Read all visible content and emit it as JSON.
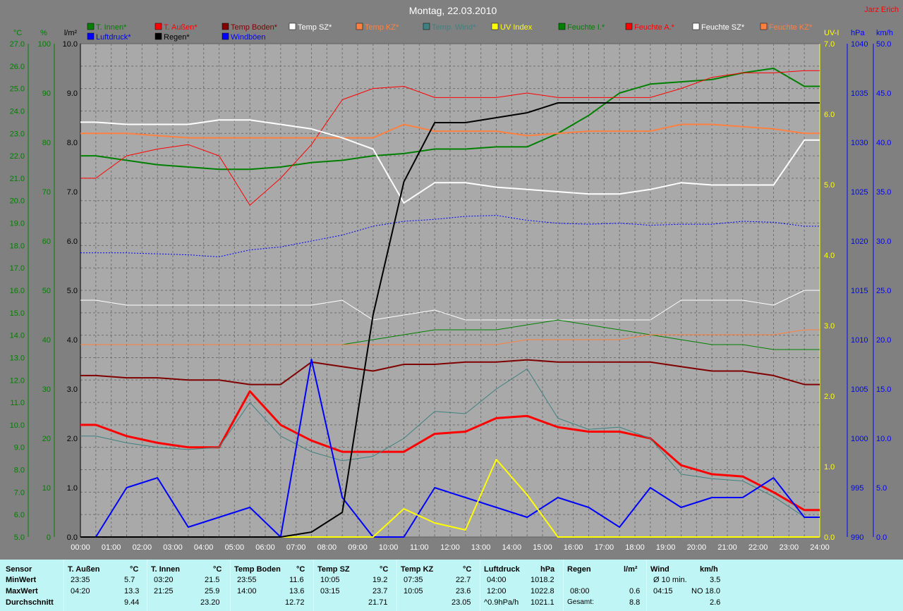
{
  "chart_data": {
    "type": "line",
    "title": "Montag, 22.03.2010",
    "author": "Jarz Erich",
    "x": [
      "00:00",
      "01:00",
      "02:00",
      "03:00",
      "04:00",
      "05:00",
      "06:00",
      "07:00",
      "08:00",
      "09:00",
      "10:00",
      "11:00",
      "12:00",
      "13:00",
      "14:00",
      "15:00",
      "16:00",
      "17:00",
      "18:00",
      "19:00",
      "20:00",
      "21:00",
      "22:00",
      "23:00",
      "24:00"
    ],
    "axes": {
      "temp_c": {
        "label": "°C",
        "ticks": [
          "27.0",
          "26.0",
          "25.0",
          "24.0",
          "23.0",
          "22.0",
          "21.0",
          "20.0",
          "19.0",
          "18.0",
          "17.0",
          "16.0",
          "15.0",
          "14.0",
          "13.0",
          "12.0",
          "11.0",
          "10.0",
          "9.0",
          "8.0",
          "7.0",
          "6.0",
          "5.0"
        ],
        "range": [
          5,
          27
        ]
      },
      "humidity_pct": {
        "label": "%",
        "ticks": [
          "100",
          "90",
          "80",
          "70",
          "60",
          "50",
          "40",
          "30",
          "20",
          "10",
          "0"
        ],
        "range": [
          0,
          100
        ]
      },
      "rain_lm2": {
        "label": "l/m²",
        "ticks": [
          "10.0",
          "9.0",
          "8.0",
          "7.0",
          "6.0",
          "5.0",
          "4.0",
          "3.0",
          "2.0",
          "1.0",
          "0.0"
        ],
        "range": [
          0,
          10
        ]
      },
      "uv": {
        "label": "UV-I",
        "ticks": [
          "7.0",
          "6.0",
          "5.0",
          "4.0",
          "3.0",
          "2.0",
          "1.0",
          "0.0"
        ],
        "range": [
          0,
          7
        ]
      },
      "pressure_hpa": {
        "label": "hPa",
        "ticks": [
          "1040",
          "1035",
          "1030",
          "1025",
          "1020",
          "1015",
          "1010",
          "1005",
          "1000",
          "995",
          "990"
        ],
        "range": [
          990,
          1040
        ]
      },
      "wind_kmh": {
        "label": "km/h",
        "ticks": [
          "50.0",
          "45.0",
          "40.0",
          "35.0",
          "30.0",
          "25.0",
          "20.0",
          "15.0",
          "10.0",
          "5.0",
          "0.0"
        ],
        "range": [
          0,
          50
        ]
      }
    },
    "legend": [
      {
        "name": "T. Innen*",
        "color": "#008000"
      },
      {
        "name": "T. Außen*",
        "color": "#ff0000"
      },
      {
        "name": "Temp Boden*",
        "color": "#800000"
      },
      {
        "name": "Temp SZ*",
        "color": "#ffffff"
      },
      {
        "name": "Temp KZ*",
        "color": "#ff8040"
      },
      {
        "name": "Temp. Wind*",
        "color": "#408080"
      },
      {
        "name": "UV Index",
        "color": "#ffff00"
      },
      {
        "name": "Feuchte I.*",
        "color": "#008000"
      },
      {
        "name": "Feuchte A.*",
        "color": "#ff0000"
      },
      {
        "name": "Feuchte SZ*",
        "color": "#ffffff"
      },
      {
        "name": "Feuchte KZ*",
        "color": "#ff8040"
      },
      {
        "name": "Luftdruck*",
        "color": "#0000ff"
      },
      {
        "name": "Regen*",
        "color": "#000000"
      },
      {
        "name": "Windböen",
        "color": "#0000ff"
      }
    ],
    "series": [
      {
        "name": "T. Innen*",
        "axis": "temp_c",
        "color": "#008000",
        "width": 2,
        "values": [
          22.0,
          21.8,
          21.6,
          21.5,
          21.4,
          21.4,
          21.5,
          21.7,
          21.8,
          22.0,
          22.1,
          22.3,
          22.3,
          22.4,
          22.4,
          23.0,
          23.8,
          24.8,
          25.2,
          25.3,
          25.4,
          25.7,
          25.9,
          25.1
        ]
      },
      {
        "name": "T. Außen*",
        "axis": "temp_c",
        "color": "#ff0000",
        "width": 1,
        "values": [
          21.0,
          22.0,
          22.3,
          22.5,
          22.0,
          19.8,
          21.0,
          22.5,
          24.5,
          25.0,
          25.1,
          24.6,
          24.6,
          24.6,
          24.8,
          24.6,
          24.6,
          24.6,
          24.6,
          25.0,
          25.5,
          25.7,
          25.7,
          25.8
        ]
      },
      {
        "name": "Temp KZ*",
        "axis": "temp_c",
        "color": "#ff8040",
        "width": 2,
        "values": [
          23.0,
          23.0,
          22.9,
          22.8,
          22.8,
          22.8,
          22.8,
          22.8,
          22.8,
          22.8,
          23.4,
          23.1,
          23.1,
          23.1,
          22.9,
          23.0,
          23.1,
          23.1,
          23.1,
          23.4,
          23.4,
          23.3,
          23.2,
          23.0
        ]
      },
      {
        "name": "Temp SZ*",
        "axis": "temp_c",
        "color": "#ffffff",
        "width": 2,
        "values": [
          23.5,
          23.4,
          23.4,
          23.4,
          23.6,
          23.6,
          23.4,
          23.2,
          22.8,
          22.3,
          19.9,
          20.8,
          20.8,
          20.6,
          20.5,
          20.4,
          20.3,
          20.3,
          20.5,
          20.8,
          20.7,
          20.7,
          20.7,
          22.7
        ]
      },
      {
        "name": "Temp Boden*",
        "axis": "temp_c",
        "color": "#800000",
        "width": 2,
        "values": [
          12.2,
          12.1,
          12.1,
          12.0,
          12.0,
          11.8,
          11.8,
          12.8,
          12.6,
          12.4,
          12.7,
          12.7,
          12.8,
          12.8,
          12.9,
          12.8,
          12.8,
          12.8,
          12.8,
          12.6,
          12.4,
          12.4,
          12.2,
          11.8
        ]
      },
      {
        "name": "T. Außen (Boden-Skala)",
        "axis": "temp_c",
        "color": "#ff0000",
        "width": 3,
        "values": [
          10.0,
          9.5,
          9.2,
          9.0,
          9.0,
          11.5,
          10.0,
          9.3,
          8.8,
          8.8,
          8.8,
          9.6,
          9.7,
          10.3,
          10.4,
          9.9,
          9.7,
          9.7,
          9.4,
          8.2,
          7.8,
          7.7,
          7.0,
          6.2
        ]
      },
      {
        "name": "Temp. Wind*",
        "axis": "temp_c",
        "color": "#408080",
        "width": 1,
        "values": [
          9.5,
          9.2,
          9.0,
          8.9,
          9.0,
          11.0,
          9.5,
          8.8,
          8.4,
          8.6,
          9.4,
          10.6,
          10.5,
          11.6,
          12.5,
          10.3,
          9.8,
          9.9,
          9.4,
          7.8,
          7.6,
          7.5,
          6.8,
          5.9
        ]
      },
      {
        "name": "Feuchte SZ*",
        "axis": "humidity_pct",
        "color": "#ffffff",
        "width": 1,
        "values": [
          48,
          47,
          47,
          47,
          47,
          47,
          47,
          47,
          48,
          44,
          45,
          46,
          44,
          44,
          44,
          44,
          44,
          44,
          44,
          48,
          48,
          48,
          47,
          50
        ]
      },
      {
        "name": "Feuchte I.*",
        "axis": "humidity_pct",
        "color": "#008000",
        "width": 1,
        "values": [
          39,
          39,
          39,
          39,
          39,
          39,
          39,
          39,
          39,
          40,
          41,
          42,
          42,
          42,
          43,
          44,
          43,
          42,
          41,
          40,
          39,
          39,
          38,
          38
        ]
      },
      {
        "name": "Feuchte KZ*",
        "axis": "humidity_pct",
        "color": "#ff8040",
        "width": 1,
        "values": [
          39,
          39,
          39,
          39,
          39,
          39,
          39,
          39,
          39,
          39,
          39,
          39,
          39,
          39,
          40,
          40,
          40,
          40,
          41,
          41,
          41,
          41,
          41,
          42
        ]
      },
      {
        "name": "Luftdruck*",
        "axis": "pressure_hpa",
        "color": "#0000ff",
        "width": 1,
        "dashed": true,
        "values": [
          1018.8,
          1018.8,
          1018.7,
          1018.6,
          1018.4,
          1019.1,
          1019.4,
          1020.0,
          1020.6,
          1021.5,
          1022.0,
          1022.2,
          1022.5,
          1022.6,
          1022.1,
          1021.8,
          1021.7,
          1021.8,
          1021.6,
          1021.7,
          1021.7,
          1022.0,
          1021.9,
          1021.5
        ]
      },
      {
        "name": "Windböen",
        "axis": "wind_kmh",
        "color": "#0000ff",
        "width": 2,
        "values": [
          0,
          5,
          6,
          1,
          2,
          3,
          0,
          18,
          4,
          0,
          0,
          5,
          4,
          3,
          2,
          4,
          3,
          1,
          5,
          3,
          4,
          4,
          6,
          2
        ]
      },
      {
        "name": "UV Index",
        "axis": "uv",
        "color": "#ffff00",
        "width": 2,
        "values": [
          0,
          0,
          0,
          0,
          0,
          0,
          0,
          0,
          0,
          0,
          0.4,
          0.2,
          0.1,
          1.1,
          0.6,
          0,
          0,
          0,
          0,
          0,
          0,
          0,
          0,
          0
        ]
      },
      {
        "name": "Regen*",
        "axis": "rain_lm2",
        "color": "#000000",
        "width": 2,
        "values": [
          0,
          0,
          0,
          0,
          0,
          0,
          0,
          0.1,
          0.5,
          4.5,
          7.2,
          8.4,
          8.4,
          8.5,
          8.6,
          8.8,
          8.8,
          8.8,
          8.8,
          8.8,
          8.8,
          8.8,
          8.8,
          8.8
        ]
      }
    ]
  },
  "stats": {
    "headers": {
      "sensor": "Sensor",
      "t_aussen": "T. Außen",
      "t_aussen_unit": "°C",
      "t_innen": "T. Innen",
      "t_innen_unit": "°C",
      "temp_boden": "Temp Boden",
      "temp_boden_unit": "°C",
      "temp_sz": "Temp SZ",
      "temp_sz_unit": "°C",
      "temp_kz": "Temp KZ",
      "temp_kz_unit": "°C",
      "luftdruck": "Luftdruck",
      "luftdruck_unit": "hPa",
      "regen": "Regen",
      "regen_unit": "l/m²",
      "wind": "Wind",
      "wind_unit": "km/h"
    },
    "row_labels": {
      "min": "MinWert",
      "max": "MaxWert",
      "avg": "Durchschnitt"
    },
    "t_aussen": {
      "min_time": "23:35",
      "min": "5.7",
      "max_time": "04:20",
      "max": "13.3",
      "avg": "9.44"
    },
    "t_innen": {
      "min_time": "03:20",
      "min": "21.5",
      "max_time": "21:25",
      "max": "25.9",
      "avg": "23.20"
    },
    "temp_boden": {
      "min_time": "23:55",
      "min": "11.6",
      "max_time": "14:00",
      "max": "13.6",
      "avg": "12.72"
    },
    "temp_sz": {
      "min_time": "10:05",
      "min": "19.2",
      "max_time": "03:15",
      "max": "23.7",
      "avg": "21.71"
    },
    "temp_kz": {
      "min_time": "07:35",
      "min": "22.7",
      "max_time": "10:05",
      "max": "23.6",
      "avg": "23.05"
    },
    "luftdruck": {
      "min_time": "04:00",
      "min": "1018.2",
      "max_time": "12:00",
      "max": "1022.8",
      "avg_label": "^0.9hPa/h",
      "avg": "1021.1"
    },
    "regen": {
      "max_time": "08:00",
      "max": "0.6",
      "avg_label": "Gesamt:",
      "avg": "8.8"
    },
    "wind": {
      "min_label": "Ø 10 min.",
      "min": "3.5",
      "max_time": "04:15",
      "max": "NO 18.0",
      "avg": "2.6"
    }
  }
}
